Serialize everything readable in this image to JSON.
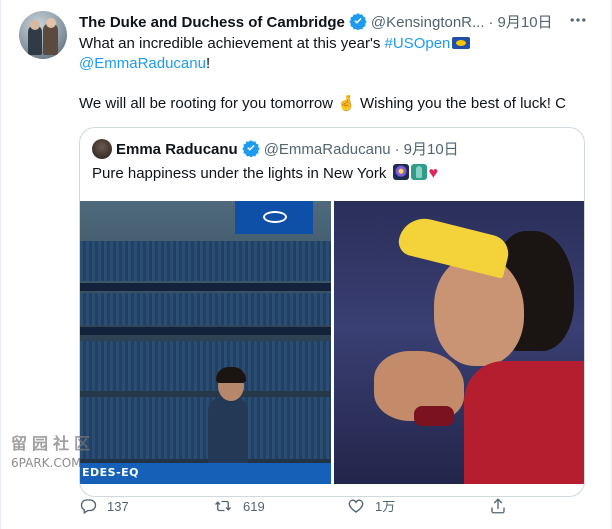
{
  "tweet": {
    "author_name": "The Duke and Duchess of Cambridge",
    "author_handle": "@KensingtonR...",
    "dot": "·",
    "date": "9月10日",
    "more_icon": "more-horizontal-icon",
    "line1_prefix": "What an incredible achievement at this year's ",
    "hashtag": "#USOpen",
    "mention": "@EmmaRaducanu",
    "mention_suffix": "!",
    "line3": "We will all be rooting for you tomorrow 🤞 Wishing you the best of luck! C"
  },
  "quote": {
    "author_name": "Emma Raducanu",
    "author_handle": "@EmmaRaducanu",
    "dot": "·",
    "date": "9月10日",
    "text": "Pure happiness under the lights in New York"
  },
  "photos": {
    "left": {
      "banner_text": "EDES-EQ"
    },
    "right": {}
  },
  "actions": {
    "reply_count": "137",
    "retweet_count": "619",
    "like_count": "1万"
  },
  "watermark": {
    "line1": "留园社区",
    "line2": "6PARK.COM"
  },
  "colors": {
    "link": "#1d9bf0",
    "secondary_text": "#536471",
    "verified": "#1d9bf0"
  }
}
